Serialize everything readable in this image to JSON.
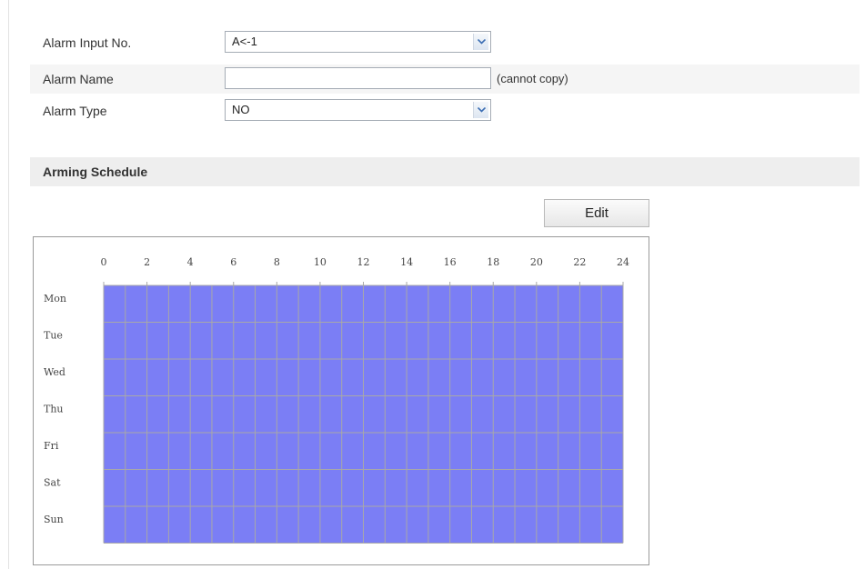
{
  "form": {
    "alarm_input": {
      "label": "Alarm Input No.",
      "value": "A<-1"
    },
    "alarm_name": {
      "label": "Alarm Name",
      "value": "",
      "hint": "(cannot copy)"
    },
    "alarm_type": {
      "label": "Alarm Type",
      "value": "NO"
    }
  },
  "arming_schedule": {
    "title": "Arming Schedule",
    "edit_label": "Edit",
    "hour_ticks": [
      "0",
      "2",
      "4",
      "6",
      "8",
      "10",
      "12",
      "14",
      "16",
      "18",
      "20",
      "22",
      "24"
    ],
    "days": [
      {
        "label": "Mon",
        "weekend": false,
        "armed_hours": [
          0,
          24
        ]
      },
      {
        "label": "Tue",
        "weekend": false,
        "armed_hours": [
          0,
          24
        ]
      },
      {
        "label": "Wed",
        "weekend": false,
        "armed_hours": [
          0,
          24
        ]
      },
      {
        "label": "Thu",
        "weekend": false,
        "armed_hours": [
          0,
          24
        ]
      },
      {
        "label": "Fri",
        "weekend": false,
        "armed_hours": [
          0,
          24
        ]
      },
      {
        "label": "Sat",
        "weekend": true,
        "armed_hours": [
          0,
          24
        ]
      },
      {
        "label": "Sun",
        "weekend": true,
        "armed_hours": [
          0,
          24
        ]
      }
    ],
    "colors": {
      "armed": "#7b7ef5",
      "weekday_label": "#444444",
      "weekend_label": "#e04a4a",
      "grid": "#a8a8a8"
    }
  }
}
